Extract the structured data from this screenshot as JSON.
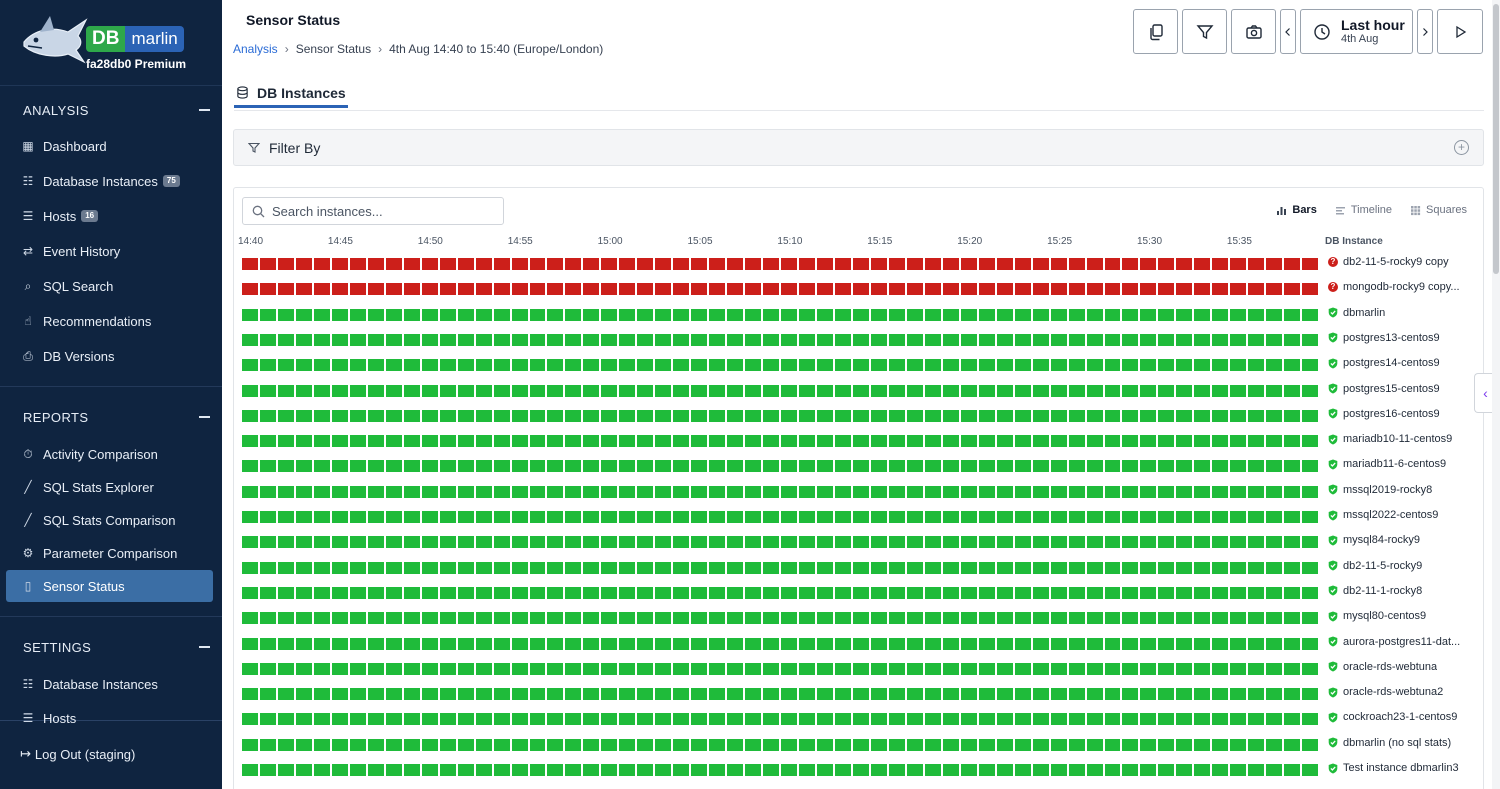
{
  "app": {
    "logo_db": "DB",
    "logo_name": "marlin",
    "tenant": "fa28db0 Premium"
  },
  "sidebar": {
    "analysis": {
      "title": "ANALYSIS",
      "items": [
        {
          "label": "Dashboard",
          "icon": "grid-icon"
        },
        {
          "label": "Database Instances",
          "icon": "database-icon",
          "badge": "75"
        },
        {
          "label": "Hosts",
          "icon": "server-icon",
          "badge": "16"
        },
        {
          "label": "Event History",
          "icon": "exchange-icon"
        },
        {
          "label": "SQL Search",
          "icon": "search-icon"
        },
        {
          "label": "Recommendations",
          "icon": "thumbs-up-icon"
        },
        {
          "label": "DB Versions",
          "icon": "document-icon"
        }
      ]
    },
    "reports": {
      "title": "REPORTS",
      "items": [
        {
          "label": "Activity Comparison",
          "icon": "stopwatch-icon"
        },
        {
          "label": "SQL Stats Explorer",
          "icon": "chart-line-icon"
        },
        {
          "label": "SQL Stats Comparison",
          "icon": "chart-line-icon"
        },
        {
          "label": "Parameter Comparison",
          "icon": "gear-icon"
        },
        {
          "label": "Sensor Status",
          "icon": "sensor-icon",
          "active": true
        }
      ]
    },
    "settings": {
      "title": "SETTINGS",
      "items": [
        {
          "label": "Database Instances",
          "icon": "database-icon"
        },
        {
          "label": "Hosts",
          "icon": "server-icon"
        }
      ]
    },
    "logout": "Log Out (staging)"
  },
  "header": {
    "title": "Sensor Status",
    "breadcrumb": {
      "root": "Analysis",
      "current": "Sensor Status",
      "range": "4th Aug 14:40 to 15:40 (Europe/London)"
    },
    "time": {
      "label": "Last hour",
      "sub": "4th Aug"
    }
  },
  "tab": {
    "label": "DB Instances"
  },
  "filter": {
    "label": "Filter By"
  },
  "panel": {
    "search_placeholder": "Search instances...",
    "views": [
      {
        "label": "Bars",
        "icon": "bars-icon",
        "active": true
      },
      {
        "label": "Timeline",
        "icon": "timeline-icon"
      },
      {
        "label": "Squares",
        "icon": "squares-icon"
      }
    ],
    "column_header": "DB Instance",
    "ticks": [
      "14:40",
      "14:45",
      "14:50",
      "14:55",
      "15:00",
      "15:05",
      "15:10",
      "15:15",
      "15:20",
      "15:25",
      "15:30",
      "15:35"
    ],
    "cells_per_row": 60,
    "colors": {
      "error": "#cc1f1a",
      "ok": "#1fbb3a"
    },
    "instances": [
      {
        "name": "db2-11-5-rocky9 copy",
        "status": "error"
      },
      {
        "name": "mongodb-rocky9 copy...",
        "status": "error"
      },
      {
        "name": "dbmarlin",
        "status": "ok"
      },
      {
        "name": "postgres13-centos9",
        "status": "ok"
      },
      {
        "name": "postgres14-centos9",
        "status": "ok"
      },
      {
        "name": "postgres15-centos9",
        "status": "ok"
      },
      {
        "name": "postgres16-centos9",
        "status": "ok"
      },
      {
        "name": "mariadb10-11-centos9",
        "status": "ok"
      },
      {
        "name": "mariadb11-6-centos9",
        "status": "ok"
      },
      {
        "name": "mssql2019-rocky8",
        "status": "ok"
      },
      {
        "name": "mssql2022-centos9",
        "status": "ok"
      },
      {
        "name": "mysql84-rocky9",
        "status": "ok"
      },
      {
        "name": "db2-11-5-rocky9",
        "status": "ok"
      },
      {
        "name": "db2-11-1-rocky8",
        "status": "ok"
      },
      {
        "name": "mysql80-centos9",
        "status": "ok"
      },
      {
        "name": "aurora-postgres11-dat...",
        "status": "ok"
      },
      {
        "name": "oracle-rds-webtuna",
        "status": "ok"
      },
      {
        "name": "oracle-rds-webtuna2",
        "status": "ok"
      },
      {
        "name": "cockroach23-1-centos9",
        "status": "ok"
      },
      {
        "name": "dbmarlin (no sql stats)",
        "status": "ok"
      },
      {
        "name": "Test instance dbmarlin3",
        "status": "ok"
      }
    ]
  }
}
